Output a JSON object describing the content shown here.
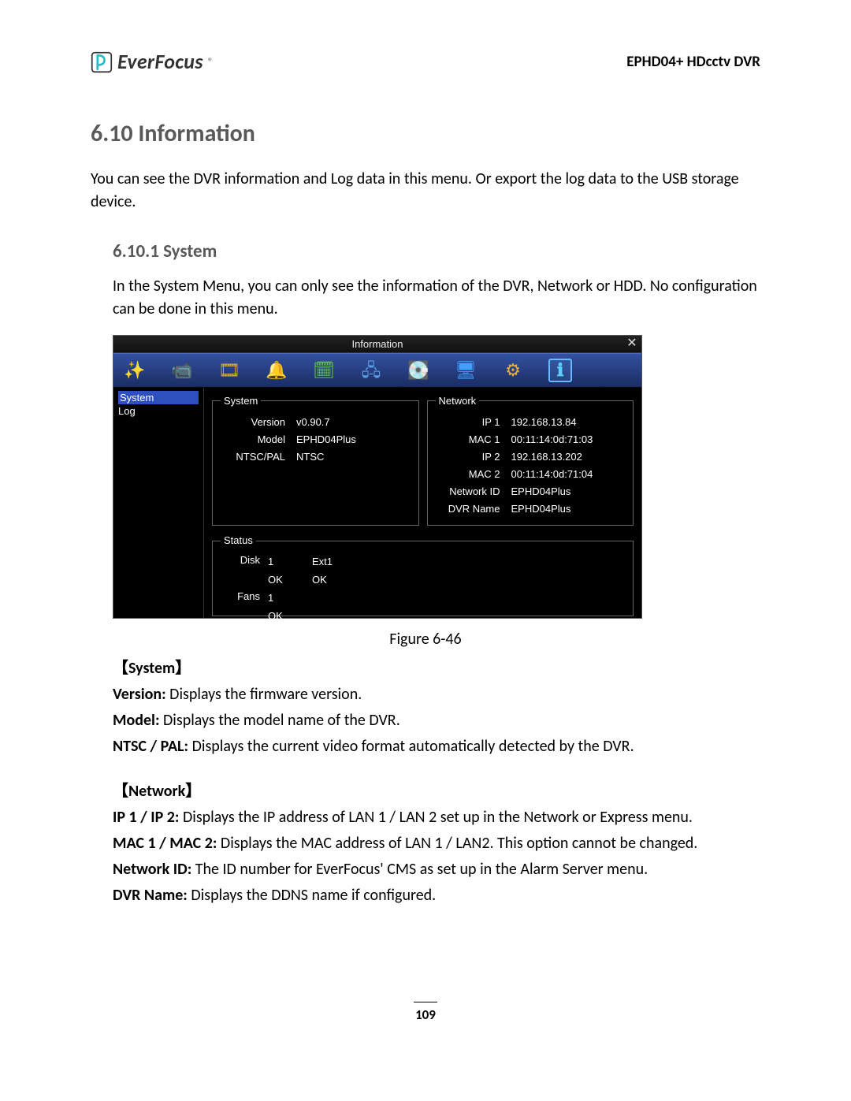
{
  "header": {
    "brand": "EverFocus",
    "trademark": "®",
    "product": "EPHD04+  HDcctv DVR"
  },
  "section": {
    "number_title": "6.10  Information",
    "intro": "You can see the DVR information and Log data in this menu. Or export the log data to the USB storage device."
  },
  "subsection": {
    "number_title": "6.10.1   System",
    "intro": "In the System Menu, you can only see the information of the DVR, Network or HDD. No configuration can be done in this menu."
  },
  "screenshot": {
    "title": "Information",
    "sidebar": {
      "items": [
        "System",
        "Log"
      ]
    },
    "system_box": {
      "legend": "System",
      "rows": [
        {
          "k": "Version",
          "v": "v0.90.7"
        },
        {
          "k": "Model",
          "v": "EPHD04Plus"
        },
        {
          "k": "NTSC/PAL",
          "v": "NTSC"
        }
      ]
    },
    "network_box": {
      "legend": "Network",
      "rows": [
        {
          "k": "IP 1",
          "v": "192.168.13.84"
        },
        {
          "k": "MAC 1",
          "v": "00:11:14:0d:71:03"
        },
        {
          "k": "IP 2",
          "v": "192.168.13.202"
        },
        {
          "k": "MAC 2",
          "v": "00:11:14:0d:71:04"
        },
        {
          "k": "Network ID",
          "v": "EPHD04Plus"
        },
        {
          "k": "DVR Name",
          "v": "EPHD04Plus"
        }
      ]
    },
    "status_box": {
      "legend": "Status",
      "disk_label": "Disk",
      "disk_headers": [
        "1",
        "Ext1"
      ],
      "disk_values": [
        "OK",
        "OK"
      ],
      "fans_label": "Fans",
      "fans_headers": [
        "1"
      ],
      "fans_values": [
        "OK"
      ]
    },
    "icons": [
      {
        "name": "wizard-icon",
        "glyph": "✨"
      },
      {
        "name": "camera-icon",
        "glyph": "📹"
      },
      {
        "name": "record-icon",
        "glyph": "🎞"
      },
      {
        "name": "alarm-icon",
        "glyph": "🔔"
      },
      {
        "name": "schedule-icon",
        "glyph": "🗓"
      },
      {
        "name": "network-icon",
        "glyph": "🖧"
      },
      {
        "name": "disk-icon",
        "glyph": "💽"
      },
      {
        "name": "display-icon",
        "glyph": "🖥"
      },
      {
        "name": "settings-icon",
        "glyph": "⚙"
      },
      {
        "name": "info-icon",
        "glyph": "ℹ"
      }
    ]
  },
  "figure_caption": "Figure 6-46",
  "desc": {
    "system": {
      "label": "【System】",
      "version_b": "Version:",
      "version_t": " Displays the firmware version.",
      "model_b": "Model:",
      "model_t": " Displays the model name of the DVR.",
      "ntsc_b": "NTSC / PAL:",
      "ntsc_t": " Displays the current video format automatically detected by the DVR."
    },
    "network": {
      "label": "【Network】",
      "ip_b": "IP 1 / IP 2:",
      "ip_t": " Displays the IP address of LAN 1 / LAN 2 set up in the Network or Express menu.",
      "mac_b": "MAC 1 / MAC 2:",
      "mac_t": " Displays the MAC address of LAN 1 / LAN2. This option cannot be changed.",
      "nid_b": "Network ID:",
      "nid_t": " The ID number for EverFocus' CMS as set up in the Alarm Server menu.",
      "dvr_b": "DVR Name:",
      "dvr_t": " Displays the DDNS name if configured."
    }
  },
  "page_number": "109"
}
